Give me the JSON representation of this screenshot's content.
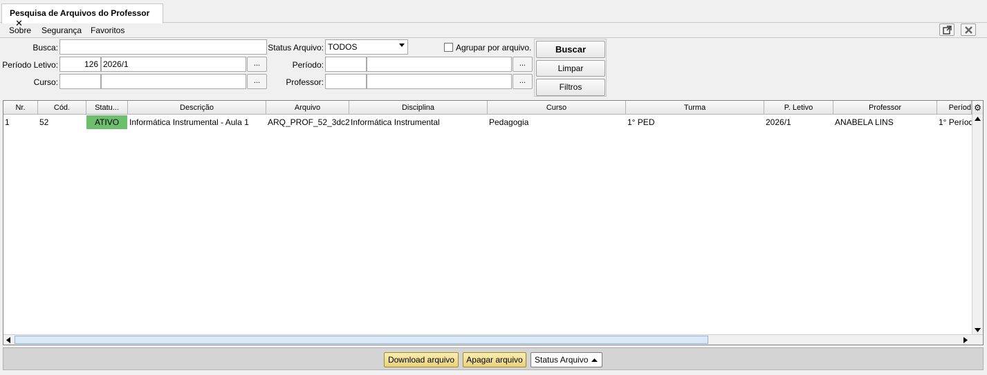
{
  "tab": {
    "title": "Pesquisa de Arquivos do Professor",
    "close": "✕"
  },
  "menu": {
    "sobre": "Sobre",
    "seguranca": "Segurança",
    "favoritos": "Favoritos"
  },
  "form": {
    "busca_label": "Busca:",
    "busca_value": "",
    "periodo_letivo_label": "Período Letivo:",
    "periodo_letivo_code": "126",
    "periodo_letivo_desc": "2026/1",
    "curso_label": "Curso:",
    "curso_code": "",
    "curso_desc": "",
    "status_label": "Status Arquivo:",
    "status_value": "TODOS",
    "agrupar_label": "Agrupar por arquivo.",
    "periodo_label": "Período:",
    "periodo_code": "",
    "periodo_desc": "",
    "professor_label": "Professor:",
    "professor_code": "",
    "professor_desc": "",
    "dots": "...",
    "buscar": "Buscar",
    "limpar": "Limpar",
    "filtros": "Filtros"
  },
  "grid": {
    "columns": [
      "Nr.",
      "Cód.",
      "Statu...",
      "Descrição",
      "Arquivo",
      "Disciplina",
      "Curso",
      "Turma",
      "P. Letivo",
      "Professor",
      "Períod"
    ],
    "rows": [
      [
        "1",
        "52",
        "ATIVO",
        "Informática Instrumental - Aula 1",
        "ARQ_PROF_52_3dc2...",
        "Informática Instrumental",
        "Pedagogia",
        "1° PED",
        "2026/1",
        "ANABELA LINS",
        "1° Períod"
      ]
    ],
    "status_color": "#6dbf6d"
  },
  "bottom": {
    "download": "Download arquivo",
    "apagar": "Apagar arquivo",
    "status": "Status Arquivo"
  }
}
